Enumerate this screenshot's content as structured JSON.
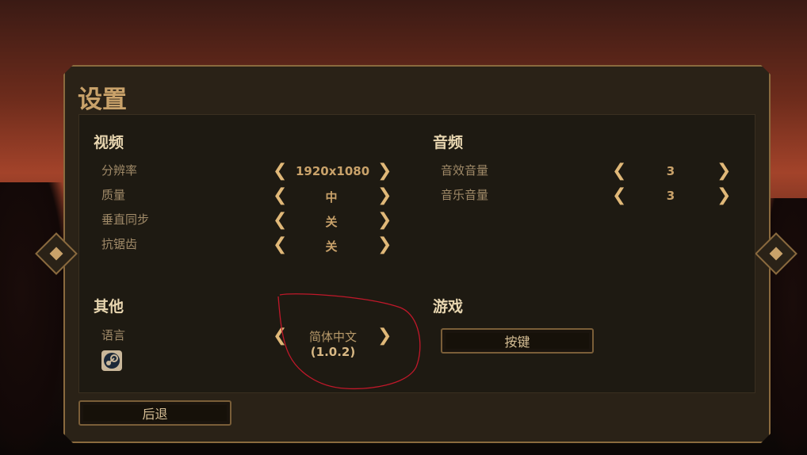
{
  "title": "设置",
  "video": {
    "title": "视频",
    "settings": [
      {
        "label": "分辨率",
        "value": "1920x1080"
      },
      {
        "label": "质量",
        "value": "中"
      },
      {
        "label": "垂直同步",
        "value": "关"
      },
      {
        "label": "抗锯齿",
        "value": "关"
      }
    ]
  },
  "audio": {
    "title": "音频",
    "settings": [
      {
        "label": "音效音量",
        "value": "3"
      },
      {
        "label": "音乐音量",
        "value": "3"
      }
    ]
  },
  "other": {
    "title": "其他",
    "language_label": "语言",
    "language_value": "简体中文",
    "version": "(1.0.2)"
  },
  "game": {
    "title": "游戏",
    "keybind_button": "按键"
  },
  "back_button": "后退",
  "arrows": {
    "left": "❮",
    "right": "❯"
  },
  "colors": {
    "accent": "#c9a26a",
    "panel": "#2a2217",
    "annotation": "#c0182a"
  },
  "icons": {
    "steam": "steam-icon",
    "nav_left": "diamond-icon",
    "nav_right": "diamond-icon"
  }
}
